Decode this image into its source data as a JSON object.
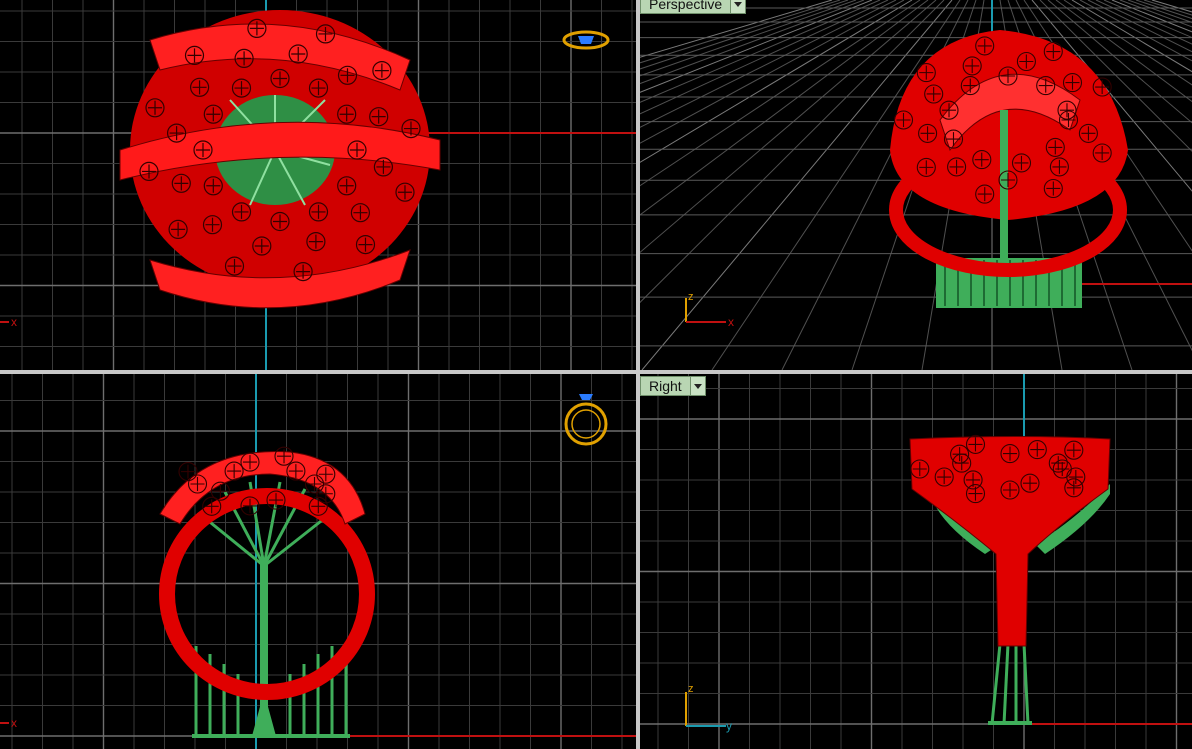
{
  "viewports": {
    "top": {
      "axis_x": "x"
    },
    "perspective": {
      "label": "Perspective",
      "axis_x": "x",
      "axis_z": "z"
    },
    "front": {
      "axis_x": "x"
    },
    "right": {
      "label": "Right",
      "axis_y": "y",
      "axis_z": "z"
    }
  },
  "colors": {
    "background": "#000000",
    "grid_minor": "#3a3a3a",
    "grid_major": "#7a7a7a",
    "axis_x": "#c01010",
    "axis_y": "#1a9bb0",
    "ring_red": "#e00000",
    "support_green": "#3fae5a",
    "gizmo_gold": "#e0a000",
    "gizmo_blue": "#2a7cff"
  },
  "icons": [
    "ring-top-gizmo-icon",
    "ring-front-gizmo-icon",
    "dropdown-arrow-icon"
  ]
}
